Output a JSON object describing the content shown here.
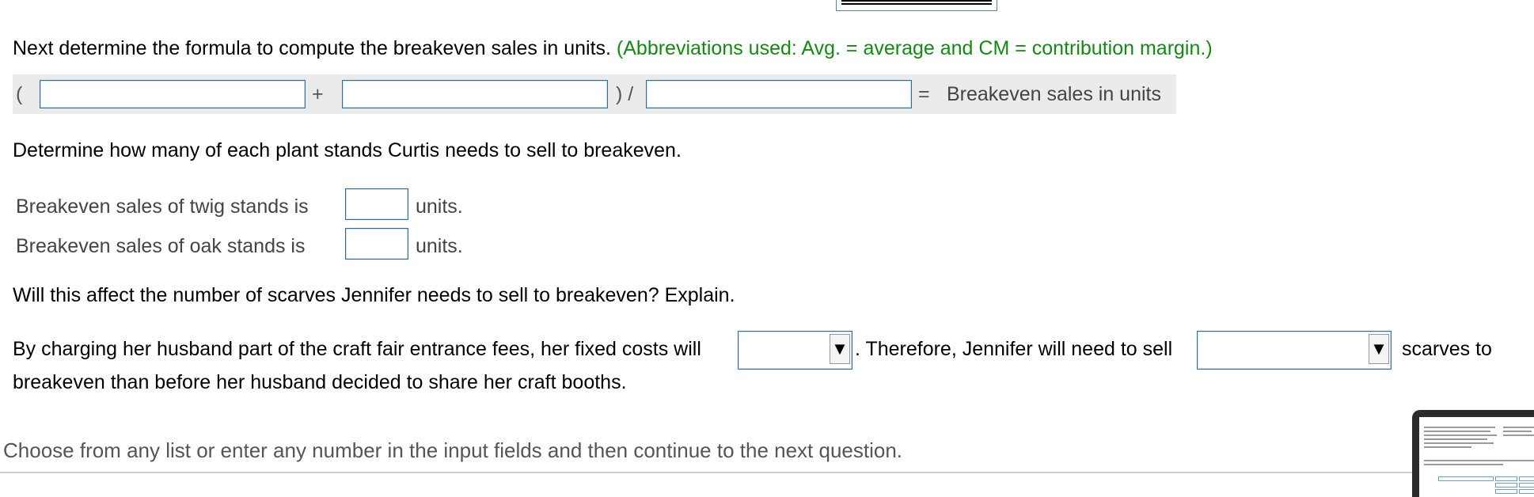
{
  "formula": {
    "instruction": "Next determine the formula to compute the breakeven sales in units.",
    "abbrev_note": "(Abbreviations used: Avg. = average and CM = contribution margin.)",
    "open_paren": "(",
    "plus": "+",
    "close_paren_div": ") /",
    "equals": "=",
    "result_label": "Breakeven sales in units",
    "input1_value": "",
    "input2_value": "",
    "input3_value": ""
  },
  "breakeven": {
    "instruction": "Determine how many of each plant stands Curtis needs to sell to breakeven.",
    "twig_label": "Breakeven sales of twig stands is",
    "twig_value": "",
    "twig_units": "units.",
    "oak_label": "Breakeven sales of oak stands is",
    "oak_value": "",
    "oak_units": "units."
  },
  "scarves": {
    "question": "Will this affect the number of scarves Jennifer needs to sell to breakeven? Explain.",
    "sentence_part1": "By charging her husband part of the craft fair entrance fees, her fixed costs will",
    "select1_value": "",
    "sentence_part2": ". Therefore, Jennifer will need to sell",
    "select2_value": "",
    "sentence_part3": "scarves to",
    "sentence_line2": "breakeven than before her husband decided to share her craft booths.",
    "dropdown_icon": "▼"
  },
  "footer": {
    "hint": "Choose from any list or enter any number in the input fields and then continue to the next question."
  }
}
